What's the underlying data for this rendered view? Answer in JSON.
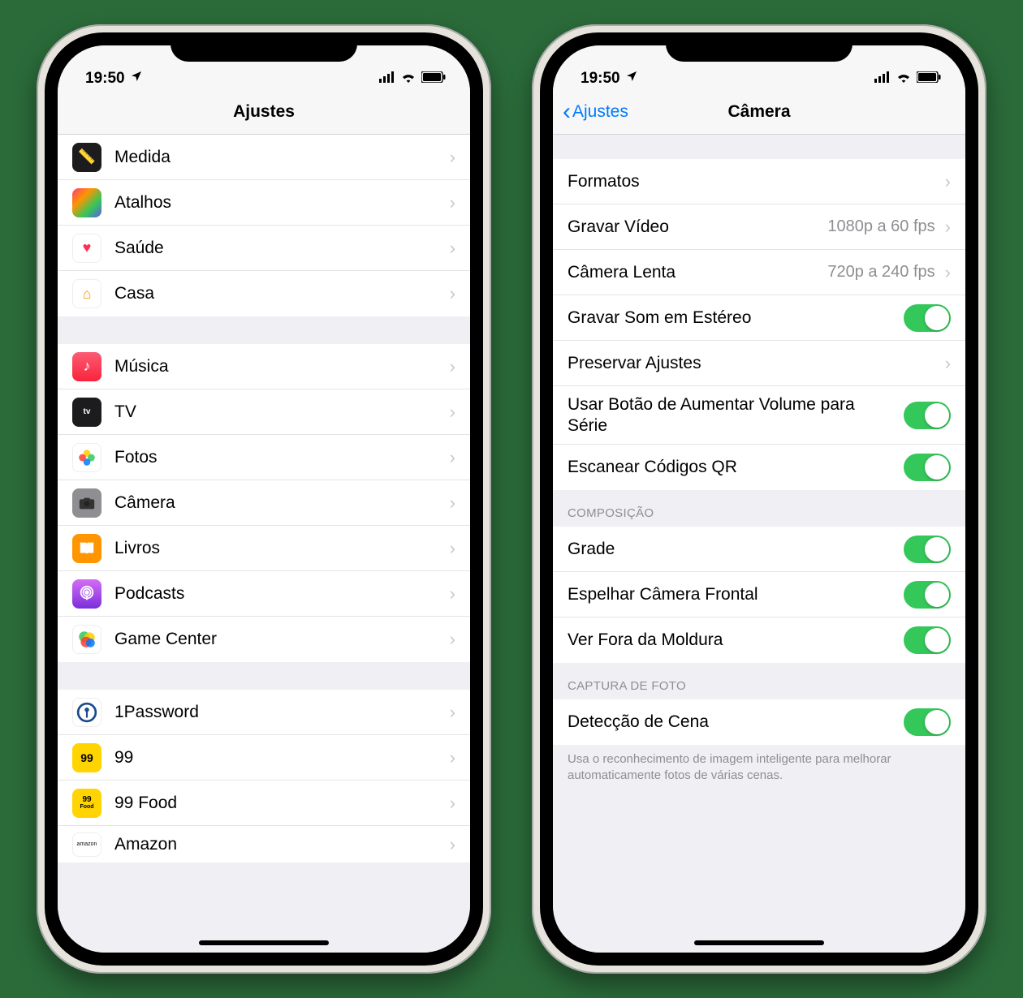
{
  "status": {
    "time": "19:50",
    "location_icon": "location-arrow",
    "signal_icon": "cellular",
    "wifi_icon": "wifi",
    "battery_icon": "battery-full"
  },
  "left": {
    "title": "Ajustes",
    "groups": [
      {
        "rows": [
          {
            "icon": "medida",
            "label": "Medida",
            "iconColor": "#1c1c1e"
          },
          {
            "icon": "atalhos",
            "label": "Atalhos",
            "iconColor": "#2f3653"
          },
          {
            "icon": "saude",
            "label": "Saúde",
            "iconColor": "#ffffff"
          },
          {
            "icon": "casa",
            "label": "Casa",
            "iconColor": "#ffffff"
          }
        ]
      },
      {
        "rows": [
          {
            "icon": "musica",
            "label": "Música",
            "iconColor": "#fc3c44"
          },
          {
            "icon": "tv",
            "label": "TV",
            "iconColor": "#1c1c1e"
          },
          {
            "icon": "fotos",
            "label": "Fotos",
            "iconColor": "#ffffff"
          },
          {
            "icon": "camera",
            "label": "Câmera",
            "iconColor": "#8e8e93"
          },
          {
            "icon": "livros",
            "label": "Livros",
            "iconColor": "#ff9500"
          },
          {
            "icon": "podcasts",
            "label": "Podcasts",
            "iconColor": "#9a3ee0"
          },
          {
            "icon": "gamecenter",
            "label": "Game Center",
            "iconColor": "#ffffff"
          }
        ]
      },
      {
        "rows": [
          {
            "icon": "1password",
            "label": "1Password",
            "iconColor": "#ffffff"
          },
          {
            "icon": "99",
            "label": "99",
            "iconColor": "#ffd400"
          },
          {
            "icon": "99food",
            "label": "99 Food",
            "iconColor": "#ffd400"
          },
          {
            "icon": "amazon",
            "label": "Amazon",
            "iconColor": "#ffffff"
          }
        ]
      }
    ]
  },
  "right": {
    "back": "Ajustes",
    "title": "Câmera",
    "sections": [
      {
        "header": null,
        "footer": null,
        "rows": [
          {
            "label": "Formatos",
            "type": "nav"
          },
          {
            "label": "Gravar Vídeo",
            "value": "1080p a 60 fps",
            "type": "nav"
          },
          {
            "label": "Câmera Lenta",
            "value": "720p a 240 fps",
            "type": "nav"
          },
          {
            "label": "Gravar Som em Estéreo",
            "type": "toggle",
            "on": true
          },
          {
            "label": "Preservar Ajustes",
            "type": "nav"
          },
          {
            "label": "Usar Botão de Aumentar Volume para Série",
            "type": "toggle",
            "on": true
          },
          {
            "label": "Escanear Códigos QR",
            "type": "toggle",
            "on": true
          }
        ]
      },
      {
        "header": "COMPOSIÇÃO",
        "footer": null,
        "rows": [
          {
            "label": "Grade",
            "type": "toggle",
            "on": true
          },
          {
            "label": "Espelhar Câmera Frontal",
            "type": "toggle",
            "on": true
          },
          {
            "label": "Ver Fora da Moldura",
            "type": "toggle",
            "on": true
          }
        ]
      },
      {
        "header": "CAPTURA DE FOTO",
        "footer": "Usa o reconhecimento de imagem inteligente para melhorar automaticamente fotos de várias cenas.",
        "rows": [
          {
            "label": "Detecção de Cena",
            "type": "toggle",
            "on": true
          }
        ]
      }
    ]
  }
}
